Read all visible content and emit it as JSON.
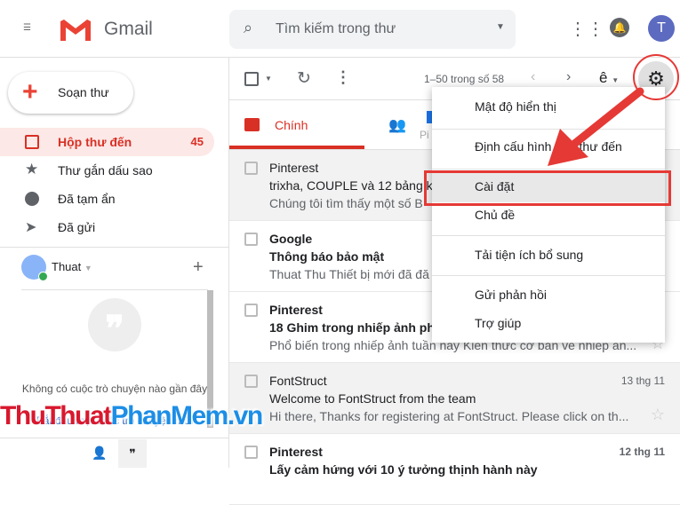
{
  "header": {
    "app_name": "Gmail",
    "search_placeholder": "Tìm kiếm trong thư",
    "avatar_initial": "T"
  },
  "sidebar": {
    "compose": "Soạn thư",
    "items": [
      {
        "label": "Hộp thư đến",
        "count": "45"
      },
      {
        "label": "Thư gắn dấu sao"
      },
      {
        "label": "Đã tạm ẩn"
      },
      {
        "label": "Đã gửi"
      }
    ],
    "hangouts": {
      "user": "Thuat",
      "empty": "Không có cuộc trò chuyện nào gần đây",
      "start_link": "Bắt đầu một cuộc trò chuyện mới"
    }
  },
  "toolbar": {
    "pagination": "1–50 trong số 58",
    "input_tool": "ê"
  },
  "tabs": [
    {
      "label": "Chính"
    },
    {
      "label": "Pi"
    }
  ],
  "emails": [
    {
      "from": "Pinterest",
      "subject": "trixha, COUPLE và 12 bảng k",
      "snippet": "Chúng tôi tìm thấy một số B",
      "date": "",
      "unread": false
    },
    {
      "from": "Google",
      "subject": "Thông báo bảo mật",
      "snippet": "Thuat Thu Thiết bị mới đã đă",
      "date": "",
      "unread": true
    },
    {
      "from": "Pinterest",
      "subject": "18 Ghim trong nhiếp ảnh phổ",
      "snippet": "Phổ biến trong nhiếp ảnh tuần này Kiến thức cơ bản về nhiếp ản...",
      "date": "",
      "unread": true
    },
    {
      "from": "FontStruct",
      "subject": "Welcome to FontStruct from the team",
      "snippet": "Hi there, Thanks for registering at FontStruct. Please click on th...",
      "date": "13 thg 11",
      "unread": false
    },
    {
      "from": "Pinterest",
      "subject": "Lấy cảm hứng với 10 ý tưởng thịnh hành này",
      "snippet": "",
      "date": "12 thg 11",
      "unread": true
    }
  ],
  "settings_menu": {
    "items": [
      "Mật độ hiển thị",
      "Định cấu hình hộp thư đến",
      "Cài đặt",
      "Chủ đề",
      "Tải tiện ích bổ sung",
      "Gửi phản hồi",
      "Trợ giúp"
    ],
    "highlighted": "Cài đặt"
  },
  "watermark": {
    "part1": "ThuThuat",
    "part2": "PhanMem",
    "part3": ".vn"
  },
  "colors": {
    "accent": "#d93025",
    "annotation": "#e53935",
    "link": "#1a73e8"
  }
}
